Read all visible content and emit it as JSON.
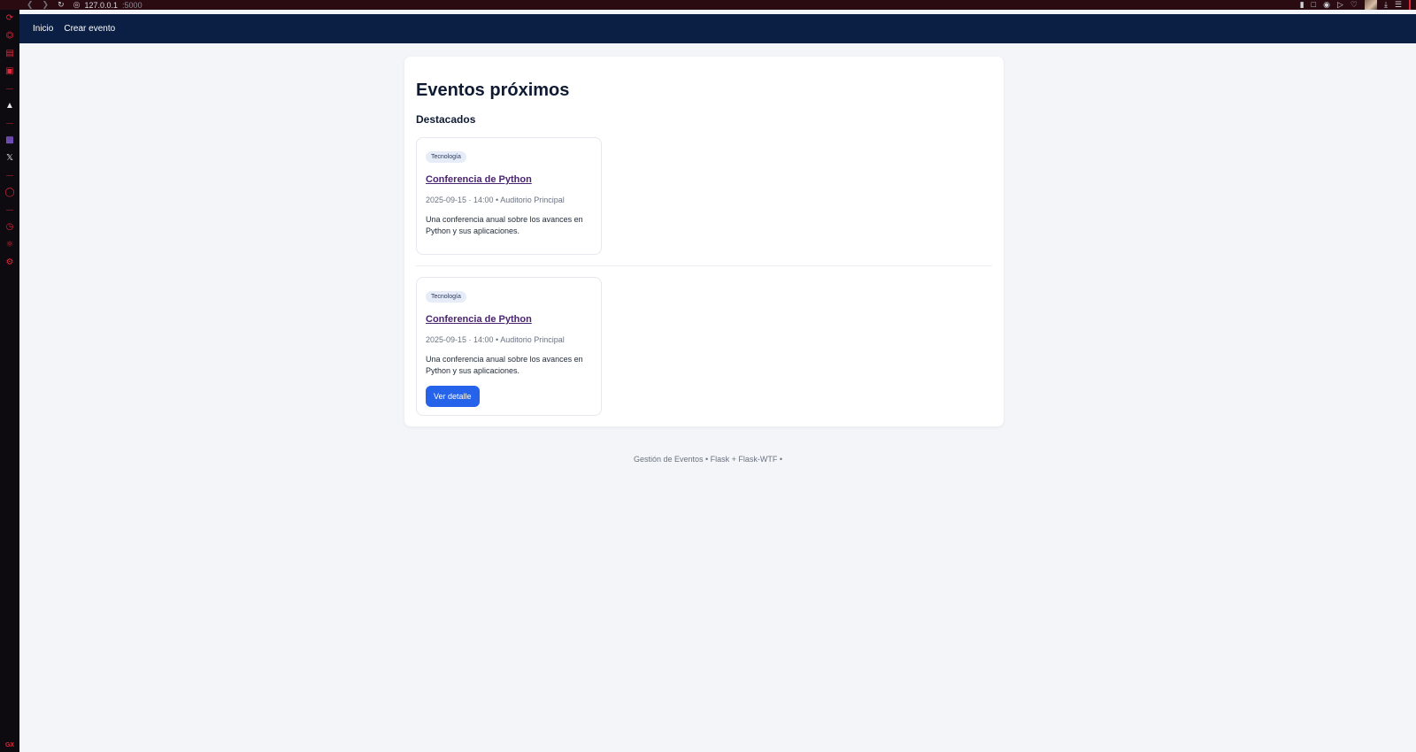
{
  "browser": {
    "url_host": "127.0.0.1",
    "url_port": ":5000"
  },
  "nav": {
    "home": "Inicio",
    "create": "Crear evento"
  },
  "page": {
    "title": "Eventos próximos",
    "section": "Destacados"
  },
  "events": [
    {
      "category": "Tecnología",
      "title": "Conferencia de Python",
      "meta": "2025-09-15 · 14:00 • Auditorio Principal",
      "description": "Una conferencia anual sobre los avances en Python y sus aplicaciones."
    },
    {
      "category": "Tecnología",
      "title": "Conferencia de Python",
      "meta": "2025-09-15 · 14:00 • Auditorio Principal",
      "description": "Una conferencia anual sobre los avances en Python y sus aplicaciones.",
      "button": "Ver detalle"
    }
  ],
  "footer": "Gestión de Eventos • Flask + Flask-WTF •",
  "colors": {
    "navbar": "#0b1f44",
    "accent": "#2563eb",
    "link": "#4a2470",
    "browser_accent": "#e0283c"
  }
}
